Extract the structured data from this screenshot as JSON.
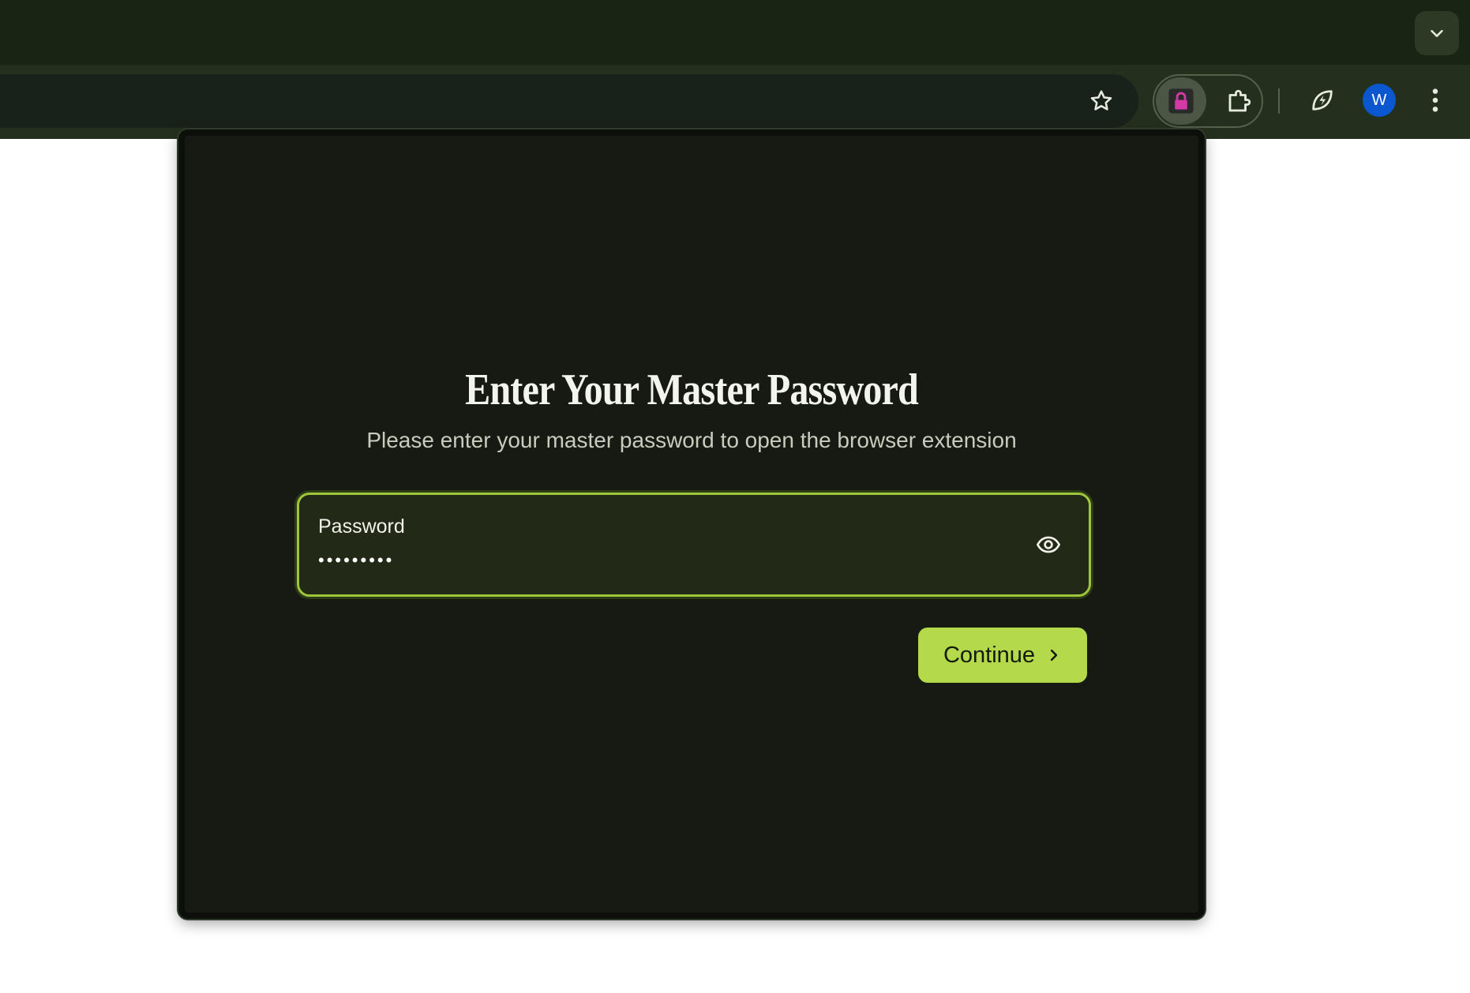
{
  "browser": {
    "avatar_initial": "W",
    "icons": {
      "tab_search": "chevron-down-icon",
      "bookmark": "star-icon",
      "pinned_extension": "lock-icon",
      "extensions": "puzzle-icon",
      "performance": "leaf-bolt-icon",
      "menu": "more-vert-icon"
    },
    "colors": {
      "tabstrip": "#1a2415",
      "toolbar": "#24301e",
      "avatar": "#0b57d0",
      "lock_accent": "#d33aa6"
    }
  },
  "popup": {
    "title": "Enter Your Master Password",
    "subtitle": "Please enter your master password to open the browser extension",
    "password_field": {
      "label": "Password",
      "value": "•••••••••",
      "toggle_icon": "eye-icon"
    },
    "continue_button": {
      "label": "Continue",
      "icon": "chevron-right-icon"
    },
    "colors": {
      "background": "#161a12",
      "accent": "#b4d94a",
      "field_border": "#9ec63a"
    }
  }
}
